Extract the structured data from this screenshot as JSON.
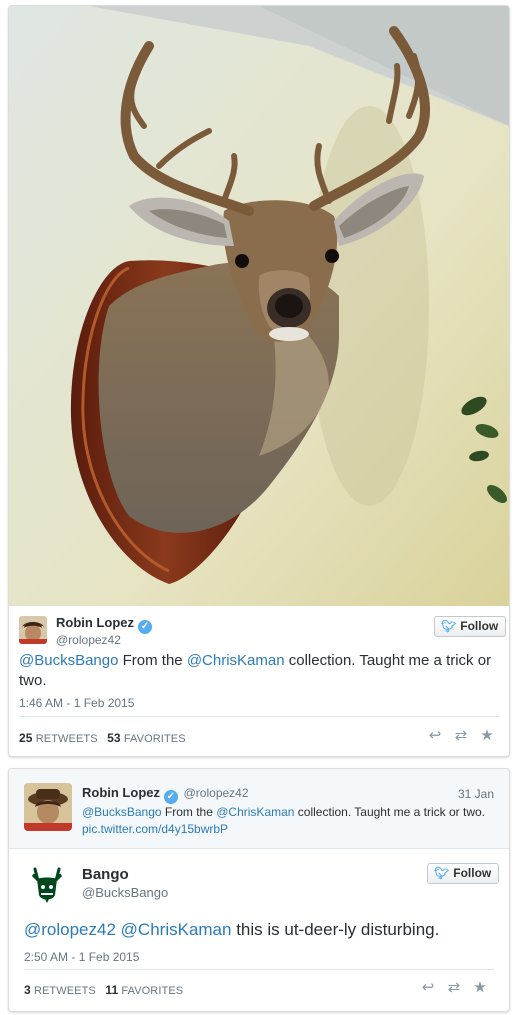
{
  "tweet1": {
    "author_name": "Robin Lopez",
    "handle": "@rolopez42",
    "follow_label": "Follow",
    "text_mention1": "@BucksBango",
    "text_part1": " From the ",
    "text_mention2": "@ChrisKaman",
    "text_part2": " collection. Taught me a trick or two.",
    "timestamp": "1:46 AM - 1 Feb 2015",
    "retweets_count": "25",
    "retweets_label": "RETWEETS",
    "favorites_count": "53",
    "favorites_label": "FAVORITES",
    "verified_icon": "✓",
    "bird_icon": "☀"
  },
  "tweet2": {
    "quoted": {
      "author_name": "Robin Lopez",
      "handle": "@rolopez42",
      "date": "31 Jan",
      "text_mention1": "@BucksBango",
      "text_part1": " From the ",
      "text_mention2": "@ChrisKaman",
      "text_part2": " collection. Taught me a trick or two.",
      "pic_link": "pic.twitter.com/d4y15bwrbP"
    },
    "author_name": "Bango",
    "handle": "@BucksBango",
    "follow_label": "Follow",
    "text_mention1": "@rolopez42",
    "text_space": " ",
    "text_mention2": "@ChrisKaman",
    "text_rest": " this is ut-deer-ly disturbing.",
    "timestamp": "2:50 AM - 1 Feb 2015",
    "retweets_count": "3",
    "retweets_label": "RETWEETS",
    "favorites_count": "11",
    "favorites_label": "FAVORITES"
  },
  "icons": {
    "reply": "↩",
    "retweet": "⇄",
    "favorite": "★"
  },
  "colors": {
    "link": "#2b7bb9",
    "twitter_blue": "#55acee",
    "bucks_green": "#00471b"
  }
}
